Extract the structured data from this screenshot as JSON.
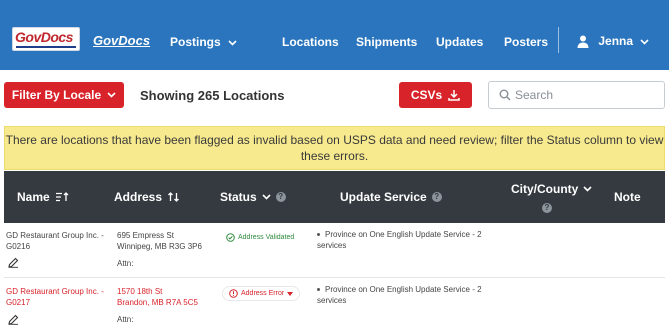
{
  "nav": {
    "logo_text": "GovDocs",
    "brand": "GovDocs",
    "postings": "Postings",
    "locations": "Locations",
    "shipments": "Shipments",
    "updates": "Updates",
    "posters": "Posters",
    "user": "Jenna"
  },
  "toolbar": {
    "filter_label": "Filter By Locale",
    "showing_text": "Showing 265 Locations",
    "csv_label": "CSVs",
    "search_placeholder": "Search"
  },
  "alert": {
    "text": "There are locations that have been flagged as invalid based on USPS data and need review; filter the Status column to view these errors."
  },
  "table": {
    "headers": {
      "name": "Name",
      "address": "Address",
      "status": "Status",
      "update_service": "Update Service",
      "city_county": "City/County",
      "note": "Note"
    },
    "rows": [
      {
        "name": "GD Restaurant Group Inc. - G0216",
        "address_line1": "695 Empress St",
        "address_line2": "Winnipeg, MB R3G 3P6",
        "attn": "Attn:",
        "status": "Address Validated",
        "update_service": "Province on One English Update Service - 2 services"
      },
      {
        "name": "GD Restaurant Group Inc. - G0217",
        "address_line1": "1570 18th St",
        "address_line2": "Brandon, MB R7A 5C5",
        "attn": "Attn:",
        "status": "Address Error",
        "update_service": "Province on One English Update Service - 2 services"
      }
    ]
  },
  "colors": {
    "navbar": "#2a75bd",
    "accent_red": "#d8232a",
    "alert_bg": "#f7e98e",
    "table_header": "#343a40",
    "valid_green": "#2f8a3f"
  },
  "icons": [
    "chevron-down-icon",
    "user-icon",
    "download-icon",
    "search-icon",
    "sort-icon",
    "help-icon",
    "check-circle-icon",
    "alert-circle-icon",
    "edit-icon"
  ]
}
